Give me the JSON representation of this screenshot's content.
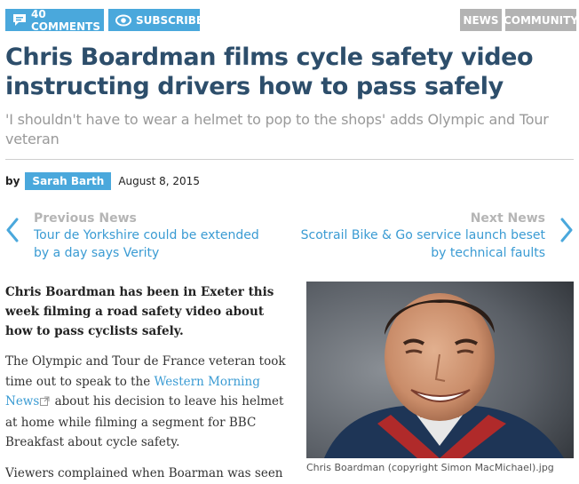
{
  "toolbar": {
    "comments_label": "40 COMMENTS",
    "subscribe_label": "SUBSCRIBE"
  },
  "tags": [
    "NEWS",
    "COMMUNITY"
  ],
  "headline": "Chris Boardman films cycle safety video instructing drivers how to pass safely",
  "subheadline": "'I shouldn't have to wear a helmet to pop to the shops' adds Olympic and Tour veteran",
  "byline": {
    "by": "by",
    "author": "Sarah Barth",
    "date": "August 8, 2015"
  },
  "navigation": {
    "previous": {
      "label": "Previous News",
      "title": "Tour de Yorkshire could be extended by a day says Verity"
    },
    "next": {
      "label": "Next News",
      "title": "Scotrail Bike & Go service launch beset by technical faults"
    }
  },
  "article": {
    "lead": "Chris Boardman has been in Exeter this week filming a road safety video about how to pass cyclists safely.",
    "para1_before": "The Olympic and Tour de France veteran took time out to speak to the ",
    "para1_link": "Western Morning News",
    "para1_after": " about his decision to leave his helmet at home while filming a segment for BBC Breakfast about cycle safety.",
    "para2": "Viewers complained when Boarman was seen"
  },
  "image": {
    "caption": "Chris Boardman (copyright Simon MacMichael).jpg"
  },
  "colors": {
    "accent": "#4aa8dc",
    "tag_grey": "#b3b3b3",
    "headline": "#2d4e6b",
    "link": "#3a9bd3"
  }
}
